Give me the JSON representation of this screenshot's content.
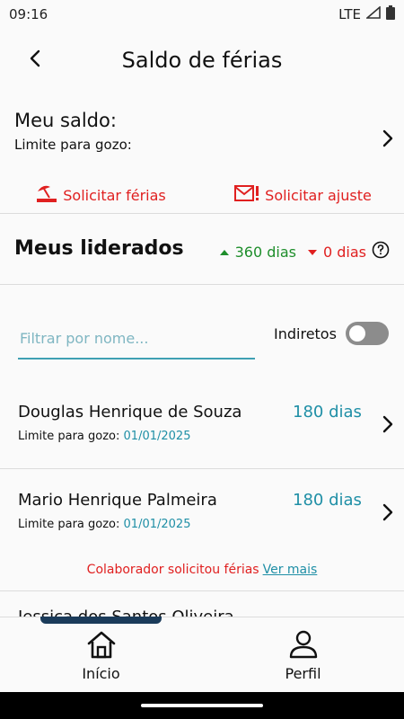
{
  "status_bar": {
    "time": "09:16",
    "network": "LTE"
  },
  "appbar": {
    "title": "Saldo de férias"
  },
  "balance": {
    "heading": "Meu saldo:",
    "limit_label": "Limite para gozo:"
  },
  "actions": {
    "request_vacation": "Solicitar férias",
    "request_adjustment": "Solicitar ajuste"
  },
  "leaders": {
    "heading": "Meus liderados",
    "up_count": "360 dias",
    "down_count": "0 dias"
  },
  "filter": {
    "placeholder": "Filtrar por nome...",
    "value": ""
  },
  "indirect": {
    "label": "Indiretos",
    "enabled": false
  },
  "employees": [
    {
      "name": "Douglas Henrique de Souza",
      "days": "180 dias",
      "limit_label": "Limite para gozo:",
      "limit_date": "01/01/2025"
    },
    {
      "name": "Mario Henrique Palmeira",
      "days": "180 dias",
      "limit_label": "Limite para gozo:",
      "limit_date": "01/01/2025"
    }
  ],
  "notice": {
    "text": "Colaborador solicitou férias",
    "link": "Ver mais"
  },
  "partial_row": {
    "name": "Jessica dos Santos Oliveira"
  },
  "bottom_nav": {
    "home": "Início",
    "profile": "Perfil"
  },
  "colors": {
    "accent": "#1f8fa6",
    "alert": "#e02020",
    "positive": "#1e8e2b",
    "nav_indicator": "#1b3b5a"
  },
  "icons": {
    "status": [
      "signal-icon",
      "battery-icon"
    ],
    "appbar": "back-arrow-icon",
    "actions": [
      "beach-umbrella-icon",
      "mail-alert-icon"
    ],
    "leaders": [
      "triangle-up-icon",
      "triangle-down-icon",
      "help-circle-icon"
    ],
    "nav": [
      "home-icon",
      "person-icon"
    ]
  }
}
